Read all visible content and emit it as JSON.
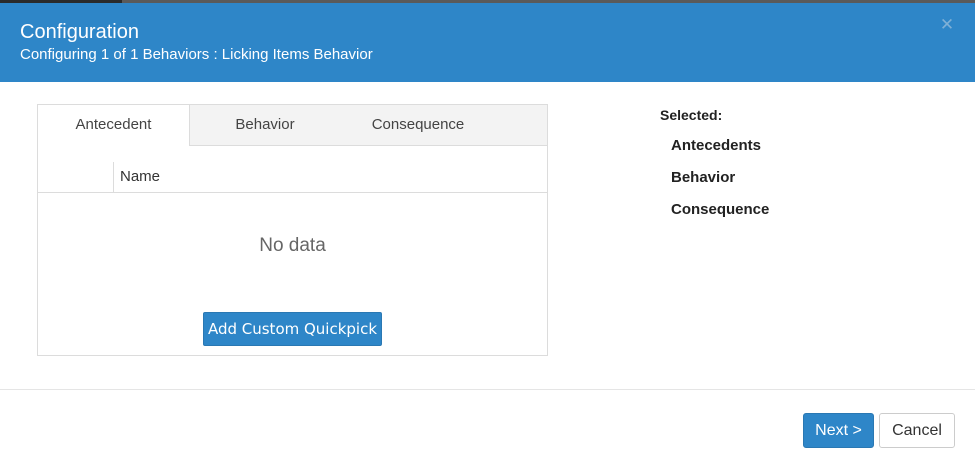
{
  "header": {
    "title": "Configuration",
    "subtitle": "Configuring 1 of 1 Behaviors : Licking Items Behavior",
    "close_icon": "close-icon",
    "background_color": "#2e86c8"
  },
  "tabs": [
    {
      "label": "Antecedent",
      "active": true
    },
    {
      "label": "Behavior",
      "active": false
    },
    {
      "label": "Consequence",
      "active": false
    }
  ],
  "table": {
    "columns": [
      "Name"
    ],
    "empty_text": "No data"
  },
  "add_button_label": "Add Custom Quickpick",
  "selected": {
    "label": "Selected:",
    "items": [
      "Antecedents",
      "Behavior",
      "Consequence"
    ]
  },
  "footer": {
    "next_label": "Next >",
    "cancel_label": "Cancel"
  }
}
